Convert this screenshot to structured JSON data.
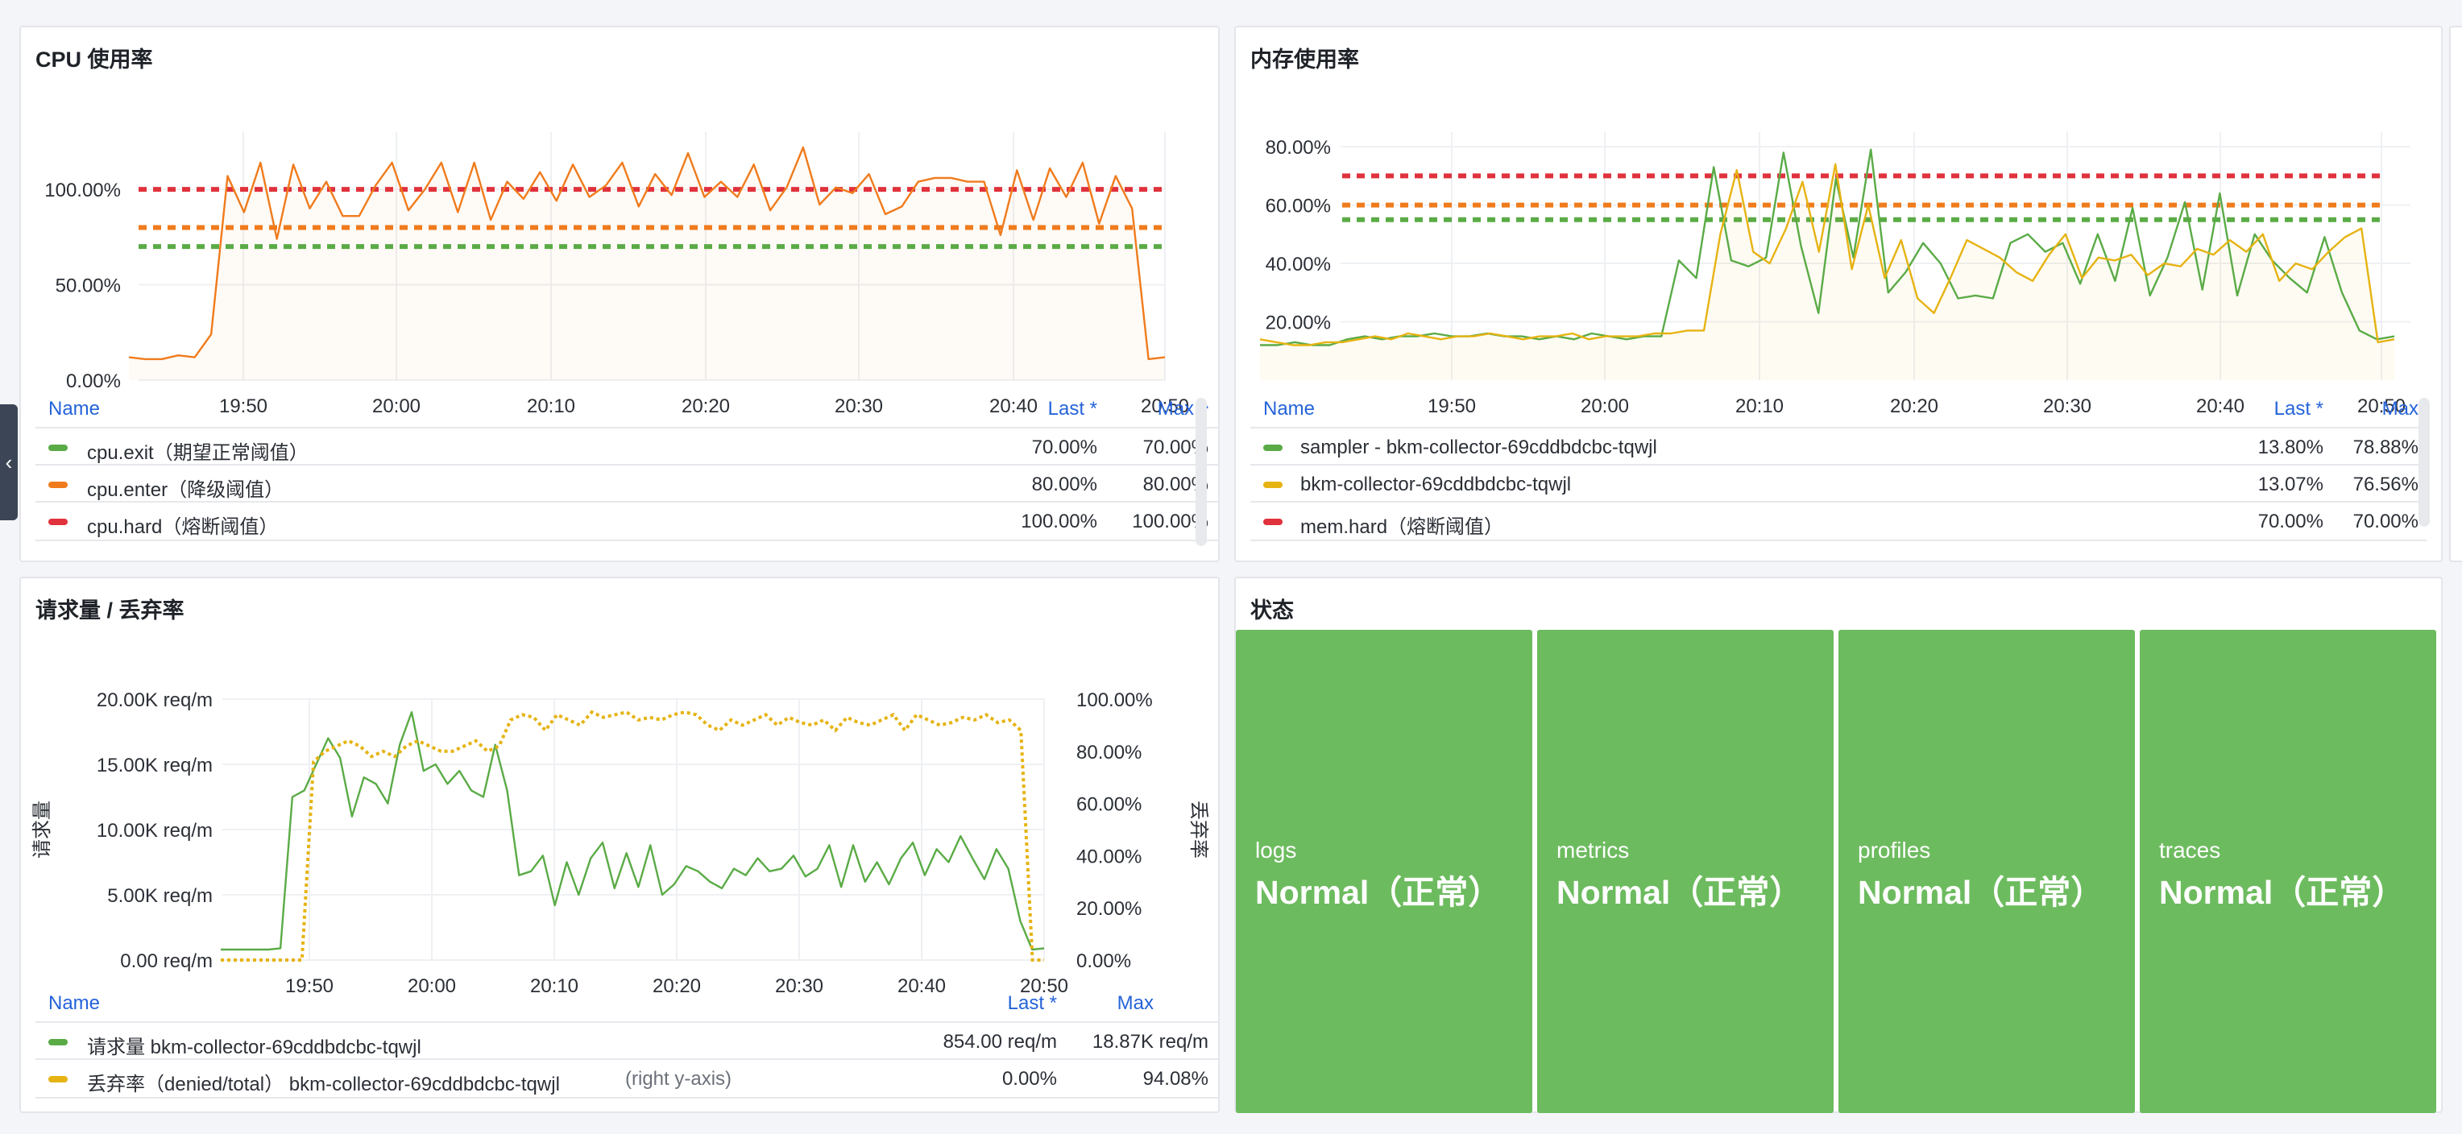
{
  "sidebar": {
    "collapse_icon": "chevron-left-icon"
  },
  "panels": {
    "cpu": {
      "title": "CPU 使用率",
      "chart_data": {
        "type": "line",
        "title": "CPU 使用率",
        "x_ticks": [
          "19:50",
          "20:00",
          "20:10",
          "20:20",
          "20:30",
          "20:40",
          "20:50"
        ],
        "y_ticks": [
          "0.00%",
          "50.00%",
          "100.00%"
        ],
        "ylim": [
          0,
          130
        ],
        "series": [
          {
            "name": "cpu.exit（期望正常阈值）",
            "color": "#5aab46",
            "style": "dashed",
            "values": [
              70
            ]
          },
          {
            "name": "cpu.enter（降级阈值）",
            "color": "#f07b1c",
            "style": "dashed",
            "values": [
              80
            ]
          },
          {
            "name": "cpu.hard（熔断阈值）",
            "color": "#e0323c",
            "style": "dashed",
            "values": [
              100
            ]
          },
          {
            "name": "",
            "color": "#f07b1c",
            "style": "solid",
            "values": [
              12,
              11,
              11,
              13,
              12,
              24,
              107,
              88,
              114,
              74,
              113,
              90,
              104,
              86,
              86,
              102,
              114,
              89,
              100,
              114,
              88,
              114,
              84,
              104,
              95,
              109,
              94,
              113,
              96,
              102,
              114,
              91,
              108,
              97,
              119,
              96,
              104,
              96,
              113,
              89,
              101,
              122,
              92,
              101,
              98,
              108,
              87,
              91,
              104,
              106,
              106,
              104,
              104,
              76,
              110,
              84,
              111,
              96,
              114,
              82,
              107,
              90,
              11,
              12
            ]
          }
        ]
      },
      "legend": {
        "col_name": "Name",
        "col_last": "Last *",
        "col_max": "Max ^",
        "rows": [
          {
            "name": "cpu.exit（期望正常阈值）",
            "color": "#5aab46",
            "last": "70.00%",
            "max": "70.00%"
          },
          {
            "name": "cpu.enter（降级阈值）",
            "color": "#f07b1c",
            "last": "80.00%",
            "max": "80.00%"
          },
          {
            "name": "cpu.hard（熔断阈值）",
            "color": "#e0323c",
            "last": "100.00%",
            "max": "100.00%"
          }
        ]
      }
    },
    "mem": {
      "title": "内存使用率",
      "chart_data": {
        "type": "line",
        "title": "内存使用率",
        "x_ticks": [
          "19:50",
          "20:00",
          "20:10",
          "20:20",
          "20:30",
          "20:40",
          "20:50"
        ],
        "y_ticks": [
          "20.00%",
          "40.00%",
          "60.00%",
          "80.00%"
        ],
        "ylim": [
          0,
          85
        ],
        "series": [
          {
            "name": "mem.hard（熔断阈值）",
            "color": "#e0323c",
            "style": "dashed",
            "values": [
              70
            ]
          },
          {
            "name": "",
            "color": "#f07b1c",
            "style": "dashed",
            "values": [
              60
            ]
          },
          {
            "name": "",
            "color": "#5aab46",
            "style": "dashed",
            "values": [
              55
            ]
          },
          {
            "name": "sampler - bkm-collector-69cddbdcbc-tqwjl",
            "color": "#5aab46",
            "style": "solid",
            "values": [
              12,
              12,
              13,
              12,
              12,
              14,
              15,
              14,
              15,
              15,
              16,
              15,
              15,
              16,
              15,
              15,
              14,
              15,
              14,
              16,
              15,
              14,
              15,
              15,
              41,
              35,
              73,
              41,
              39,
              42,
              78,
              46,
              23,
              69,
              42,
              79,
              30,
              37,
              47,
              40,
              28,
              29,
              28,
              47,
              50,
              44,
              47,
              33,
              50,
              34,
              59,
              29,
              42,
              61,
              31,
              64,
              29,
              50,
              41,
              35,
              30,
              49,
              30,
              17,
              14,
              15
            ]
          },
          {
            "name": "bkm-collector-69cddbdcbc-tqwjl",
            "color": "#e6b312",
            "style": "solid",
            "values": [
              14,
              13,
              12,
              12,
              13,
              13,
              14,
              15,
              14,
              16,
              15,
              14,
              15,
              15,
              16,
              15,
              14,
              15,
              15,
              16,
              14,
              15,
              15,
              15,
              16,
              16,
              17,
              17,
              50,
              72,
              44,
              40,
              52,
              68,
              44,
              74,
              38,
              60,
              35,
              48,
              28,
              23,
              35,
              48,
              45,
              42,
              37,
              34,
              43,
              50,
              35,
              42,
              41,
              43,
              36,
              40,
              39,
              45,
              43,
              48,
              44,
              50,
              34,
              40,
              38,
              44,
              49,
              52,
              13,
              14
            ]
          }
        ]
      },
      "legend": {
        "col_name": "Name",
        "col_last": "Last *",
        "col_max": "Max",
        "rows": [
          {
            "name": "sampler - bkm-collector-69cddbdcbc-tqwjl",
            "color": "#5aab46",
            "last": "13.80%",
            "max": "78.88%"
          },
          {
            "name": "bkm-collector-69cddbdcbc-tqwjl",
            "color": "#e6b312",
            "last": "13.07%",
            "max": "76.56%"
          },
          {
            "name": "mem.hard（熔断阈值）",
            "color": "#e0323c",
            "last": "70.00%",
            "max": "70.00%"
          }
        ]
      }
    },
    "req": {
      "title": "请求量 / 丢弃率",
      "chart_data": {
        "type": "line",
        "title": "请求量 / 丢弃率",
        "ylabel_left": "请求量",
        "ylabel_right": "丢弃率",
        "x_ticks": [
          "19:50",
          "20:00",
          "20:10",
          "20:20",
          "20:30",
          "20:40",
          "20:50"
        ],
        "y_ticks_left": [
          "0.00 req/m",
          "5.00K req/m",
          "10.00K req/m",
          "15.00K req/m",
          "20.00K req/m"
        ],
        "y_ticks_right": [
          "0.00%",
          "20.00%",
          "40.00%",
          "60.00%",
          "80.00%",
          "100.00%"
        ],
        "series": [
          {
            "name": "请求量 bkm-collector-69cddbdcbc-tqwjl",
            "color": "#5aab46",
            "axis": "left",
            "style": "solid",
            "values": [
              800,
              800,
              800,
              800,
              800,
              900,
              12500,
              13000,
              15000,
              17000,
              15500,
              11000,
              14000,
              13500,
              12000,
              16500,
              19000,
              14500,
              15000,
              13500,
              14500,
              13000,
              12500,
              16500,
              13000,
              6500,
              6800,
              8000,
              4200,
              7500,
              5000,
              7800,
              9000,
              5500,
              8200,
              5600,
              8800,
              5000,
              5800,
              7200,
              6800,
              6000,
              5500,
              7000,
              6500,
              7800,
              6800,
              7000,
              8000,
              6400,
              7000,
              8800,
              5600,
              8800,
              6000,
              7500,
              5800,
              7800,
              9000,
              6500,
              8500,
              7500,
              9500,
              7800,
              6200,
              8500,
              7000,
              3000,
              800,
              900
            ]
          },
          {
            "name": "丢弃率（denied/total） bkm-collector-69cddbdcbc-tqwjl",
            "color": "#e6b312",
            "axis": "right",
            "style": "dotted",
            "values": [
              0,
              0,
              0,
              0,
              0,
              0,
              0,
              0,
              76,
              80,
              82,
              84,
              82,
              78,
              80,
              78,
              82,
              84,
              82,
              80,
              80,
              82,
              84,
              80,
              82,
              92,
              94,
              93,
              88,
              94,
              92,
              90,
              95,
              93,
              94,
              95,
              92,
              93,
              92,
              94,
              95,
              94,
              90,
              88,
              92,
              90,
              92,
              94,
              90,
              93,
              91,
              90,
              92,
              88,
              93,
              91,
              90,
              92,
              94,
              88,
              94,
              92,
              90,
              91,
              93,
              92,
              94,
              91,
              92,
              88,
              0,
              0
            ]
          }
        ]
      },
      "legend": {
        "col_name": "Name",
        "col_last": "Last *",
        "col_max": "Max",
        "rows": [
          {
            "name": "请求量 bkm-collector-69cddbdcbc-tqwjl",
            "color": "#5aab46",
            "suffix": "",
            "last": "854.00 req/m",
            "max": "18.87K req/m"
          },
          {
            "name": "丢弃率（denied/total） bkm-collector-69cddbdcbc-tqwjl",
            "color": "#e6b312",
            "suffix": "(right y-axis)",
            "last": "0.00%",
            "max": "94.08%"
          }
        ]
      }
    },
    "status": {
      "title": "状态",
      "cells": [
        {
          "name": "logs",
          "value": "Normal（正常）"
        },
        {
          "name": "metrics",
          "value": "Normal（正常）"
        },
        {
          "name": "profiles",
          "value": "Normal（正常）"
        },
        {
          "name": "traces",
          "value": "Normal（正常）"
        }
      ],
      "color": "#6dbb5f"
    }
  }
}
